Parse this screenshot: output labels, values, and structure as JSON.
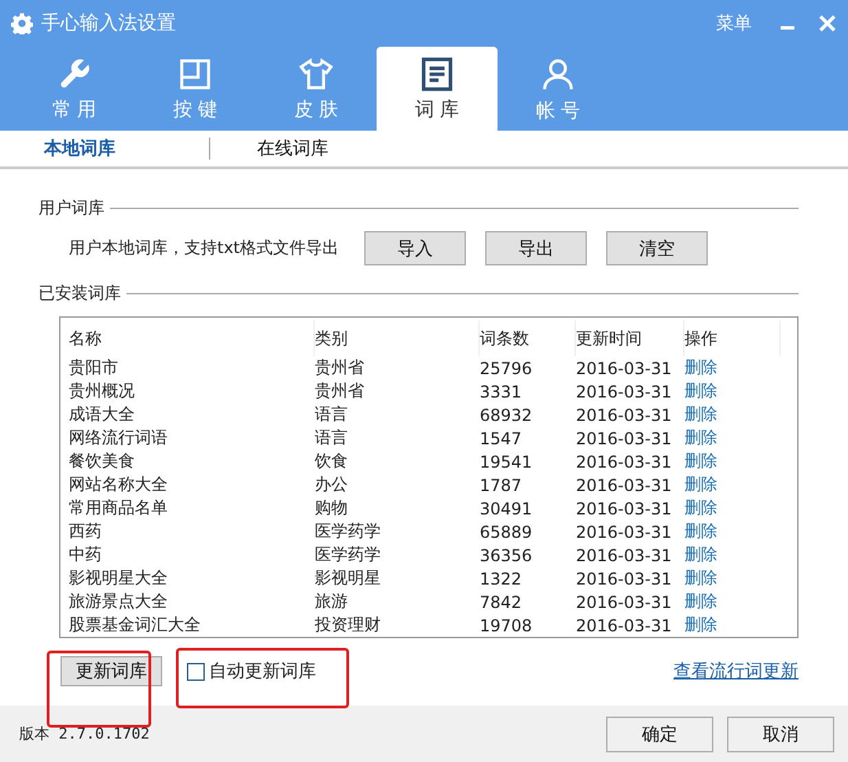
{
  "window": {
    "title": "手心输入法设置",
    "menu": "菜单"
  },
  "tabs": [
    {
      "label": "常 用",
      "kind": "wrench",
      "selected": false
    },
    {
      "label": "按 键",
      "kind": "keys",
      "selected": false
    },
    {
      "label": "皮 肤",
      "kind": "shirt",
      "selected": false
    },
    {
      "label": "词 库",
      "kind": "doc",
      "selected": true
    },
    {
      "label": "帐 号",
      "kind": "user",
      "selected": false
    }
  ],
  "subtabs": [
    {
      "label": "本地词库",
      "selected": true
    },
    {
      "label": "在线词库",
      "selected": false
    }
  ],
  "user_dict": {
    "heading": "用户词库",
    "description": "用户本地词库，支持txt格式文件导出",
    "buttons": [
      "导入",
      "导出",
      "清空"
    ]
  },
  "installed": {
    "heading": "已安装词库",
    "columns": [
      "名称",
      "类别",
      "词条数",
      "更新时间",
      "操作"
    ],
    "rows": [
      {
        "name": "贵阳市",
        "category": "贵州省",
        "count": "25796",
        "date": "2016-03-31",
        "action": "删除"
      },
      {
        "name": "贵州概况",
        "category": "贵州省",
        "count": "3331",
        "date": "2016-03-31",
        "action": "删除"
      },
      {
        "name": "成语大全",
        "category": "语言",
        "count": "68932",
        "date": "2016-03-31",
        "action": "删除"
      },
      {
        "name": "网络流行词语",
        "category": "语言",
        "count": "1547",
        "date": "2016-03-31",
        "action": "删除"
      },
      {
        "name": "餐饮美食",
        "category": "饮食",
        "count": "19541",
        "date": "2016-03-31",
        "action": "删除"
      },
      {
        "name": "网站名称大全",
        "category": "办公",
        "count": "1787",
        "date": "2016-03-31",
        "action": "删除"
      },
      {
        "name": "常用商品名单",
        "category": "购物",
        "count": "30491",
        "date": "2016-03-31",
        "action": "删除"
      },
      {
        "name": "西药",
        "category": "医学药学",
        "count": "65889",
        "date": "2016-03-31",
        "action": "删除"
      },
      {
        "name": "中药",
        "category": "医学药学",
        "count": "36356",
        "date": "2016-03-31",
        "action": "删除"
      },
      {
        "name": "影视明星大全",
        "category": "影视明星",
        "count": "1322",
        "date": "2016-03-31",
        "action": "删除"
      },
      {
        "name": "旅游景点大全",
        "category": "旅游",
        "count": "7842",
        "date": "2016-03-31",
        "action": "删除"
      },
      {
        "name": "股票基金词汇大全",
        "category": "投资理财",
        "count": "19708",
        "date": "2016-03-31",
        "action": "删除"
      }
    ]
  },
  "update_button": {
    "label": "更新词库",
    "highlighted": true
  },
  "auto_update": {
    "label": "自动更新词库",
    "checked": false,
    "highlighted": true
  },
  "popular_link": "查看流行词更新",
  "footer": {
    "version": "版本 2.7.0.1702",
    "buttons": [
      "确定",
      "取消"
    ]
  }
}
